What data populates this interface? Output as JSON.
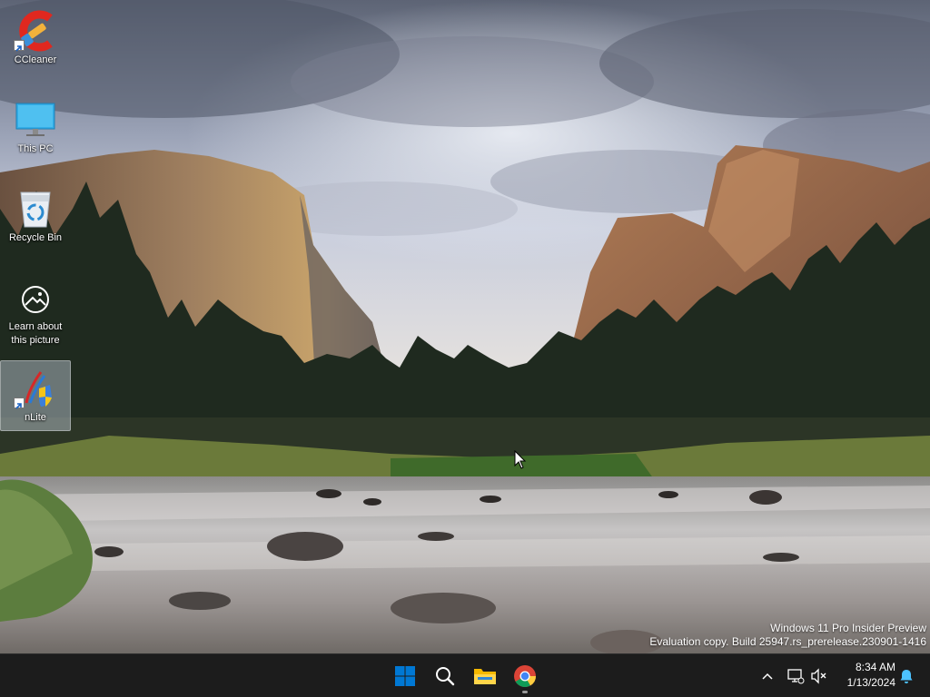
{
  "desktop": {
    "icons": [
      {
        "label": "CCleaner",
        "icon": "ccleaner-icon",
        "shortcut": true
      },
      {
        "label": "This PC",
        "icon": "monitor-icon",
        "shortcut": false
      },
      {
        "label": "Recycle Bin",
        "icon": "recycle-bin-icon",
        "shortcut": false
      },
      {
        "label": "Learn about this picture",
        "icon": "learn-about-picture-icon",
        "shortcut": false
      },
      {
        "label": "nLite",
        "icon": "nlite-icon",
        "shortcut": true,
        "selected": true
      }
    ]
  },
  "watermark": {
    "line1": "Windows 11 Pro Insider Preview",
    "line2": "Evaluation copy. Build 25947.rs_prerelease.230901-1416"
  },
  "taskbar": {
    "pinned": [
      {
        "name": "Start",
        "icon": "windows-logo-icon"
      },
      {
        "name": "Search",
        "icon": "search-icon"
      },
      {
        "name": "File Explorer",
        "icon": "file-explorer-icon"
      },
      {
        "name": "Google Chrome",
        "icon": "chrome-icon",
        "running": true
      }
    ],
    "tray": {
      "icons": [
        "chevron-up-icon",
        "network-icon",
        "volume-muted-icon",
        "notification-bell-icon"
      ],
      "time": "8:34 AM",
      "date": "1/13/2024"
    }
  },
  "colors": {
    "taskbar_bg": "#1c1c1c",
    "windows_blue": "#0078d4",
    "bell_blue": "#4cc2ff"
  }
}
